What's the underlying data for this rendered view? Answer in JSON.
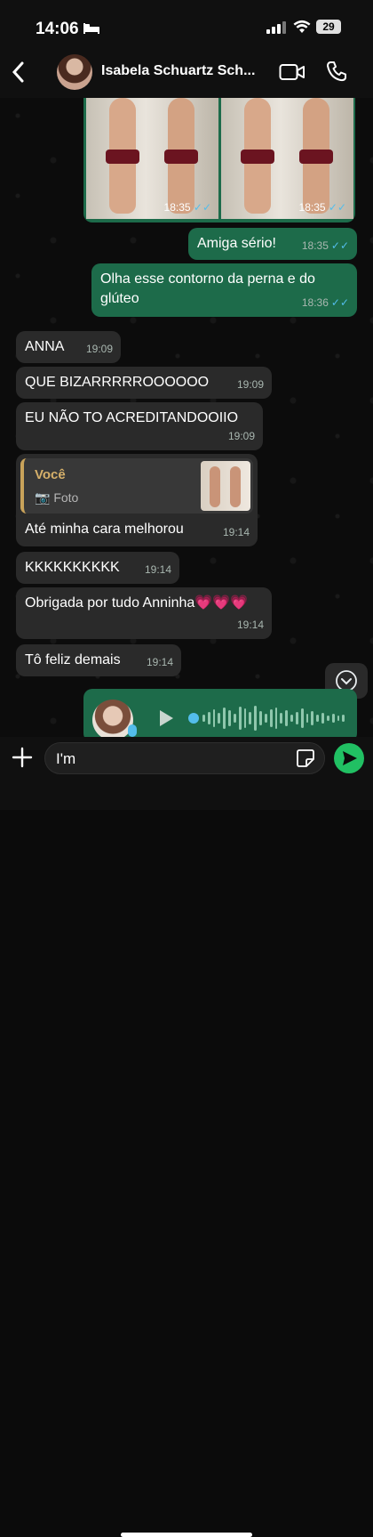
{
  "status_bar": {
    "time": "14:06",
    "battery": "29"
  },
  "header": {
    "contact_name": "Isabela Schuartz Sch..."
  },
  "messages": {
    "images": [
      {
        "time": "18:35"
      },
      {
        "time": "18:35"
      }
    ],
    "m1": {
      "text": "Amiga sério!",
      "time": "18:35"
    },
    "m2": {
      "text": "Olha esse contorno da perna e do glúteo",
      "time": "18:36"
    },
    "m3": {
      "text": "ANNA",
      "time": "19:09"
    },
    "m4": {
      "text": "QUE BIZARRRRROOOOOO",
      "time": "19:09"
    },
    "m5": {
      "text": "EU NÃO TO ACREDITANDOOIIO",
      "time": "19:09"
    },
    "m6": {
      "quote_author": "Você",
      "quote_type": "Foto",
      "text": "Até minha cara melhorou",
      "time": "19:14"
    },
    "m7": {
      "text": "KKKKKKKKKK",
      "time": "19:14"
    },
    "m8": {
      "text": "Obrigada por tudo Anninha💗💗💗",
      "time": "19:14"
    },
    "m9": {
      "text": "Tô feliz demais",
      "time": "19:14"
    }
  },
  "input": {
    "value": "I'm"
  },
  "colors": {
    "outgoing": "#1d6b4a",
    "incoming": "#2a2a2a",
    "read_ticks": "#53bdeb",
    "send": "#21c063"
  }
}
